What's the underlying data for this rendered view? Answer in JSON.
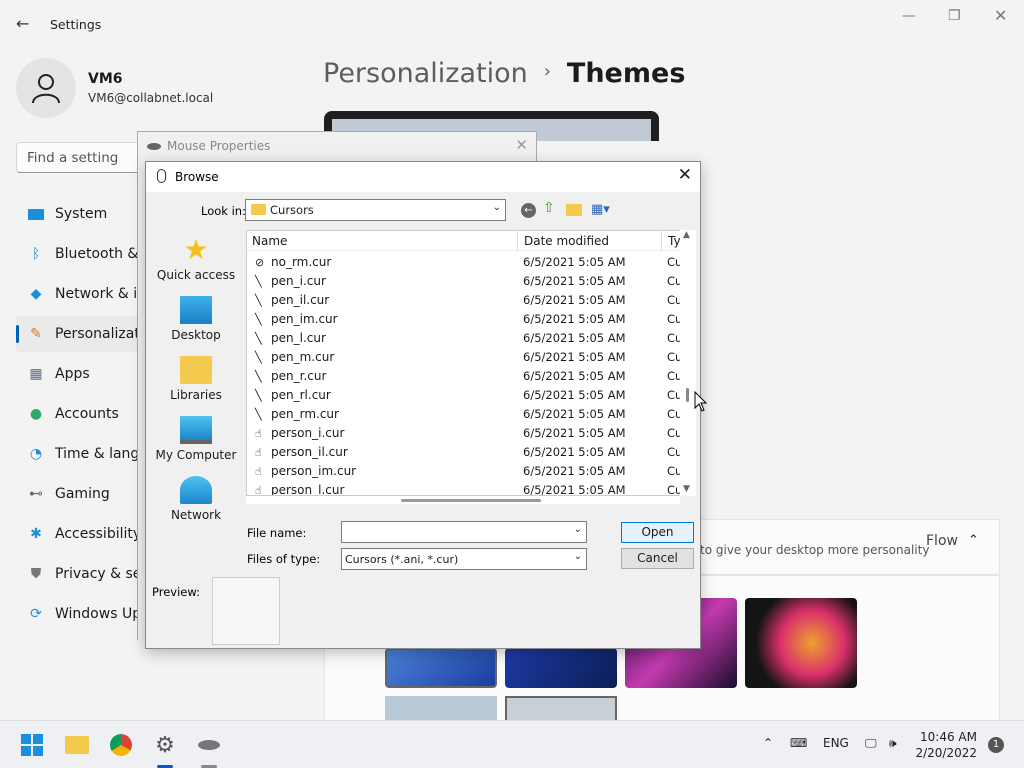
{
  "settings": {
    "title": "Settings",
    "user": {
      "name": "VM6",
      "email": "VM6@collabnet.local"
    },
    "search_placeholder": "Find a setting",
    "nav": [
      {
        "label": "System",
        "icon": "monitor-icon"
      },
      {
        "label": "Bluetooth & devices",
        "icon": "bluetooth-icon"
      },
      {
        "label": "Network & internet",
        "icon": "wifi-icon"
      },
      {
        "label": "Personalization",
        "icon": "brush-icon",
        "selected": true
      },
      {
        "label": "Apps",
        "icon": "apps-icon"
      },
      {
        "label": "Accounts",
        "icon": "person-icon"
      },
      {
        "label": "Time & language",
        "icon": "clock-globe-icon"
      },
      {
        "label": "Gaming",
        "icon": "gamepad-icon"
      },
      {
        "label": "Accessibility",
        "icon": "accessibility-icon"
      },
      {
        "label": "Privacy & security",
        "icon": "shield-icon"
      },
      {
        "label": "Windows Update",
        "icon": "update-icon"
      }
    ],
    "breadcrumb": {
      "parent": "Personalization",
      "separator": "›",
      "current": "Themes"
    },
    "card_text": "to give your desktop more personality",
    "flow_label": "Flow"
  },
  "mouse_props": {
    "title": "Mouse Properties"
  },
  "browse": {
    "title": "Browse",
    "look_in_label": "Look in:",
    "look_in_value": "Cursors",
    "places": [
      "Quick access",
      "Desktop",
      "Libraries",
      "My Computer",
      "Network"
    ],
    "columns": {
      "name": "Name",
      "date": "Date modified",
      "type": "Ty"
    },
    "files": [
      {
        "name": "no_rm.cur",
        "date": "6/5/2021 5:05 AM",
        "type": "Cu",
        "icon": "no-icon"
      },
      {
        "name": "pen_i.cur",
        "date": "6/5/2021 5:05 AM",
        "type": "Cu",
        "icon": "pen-icon"
      },
      {
        "name": "pen_il.cur",
        "date": "6/5/2021 5:05 AM",
        "type": "Cu",
        "icon": "pen-icon"
      },
      {
        "name": "pen_im.cur",
        "date": "6/5/2021 5:05 AM",
        "type": "Cu",
        "icon": "pen-icon"
      },
      {
        "name": "pen_l.cur",
        "date": "6/5/2021 5:05 AM",
        "type": "Cu",
        "icon": "pen-icon"
      },
      {
        "name": "pen_m.cur",
        "date": "6/5/2021 5:05 AM",
        "type": "Cu",
        "icon": "pen-icon"
      },
      {
        "name": "pen_r.cur",
        "date": "6/5/2021 5:05 AM",
        "type": "Cu",
        "icon": "pen-icon"
      },
      {
        "name": "pen_rl.cur",
        "date": "6/5/2021 5:05 AM",
        "type": "Cu",
        "icon": "pen-icon"
      },
      {
        "name": "pen_rm.cur",
        "date": "6/5/2021 5:05 AM",
        "type": "Cu",
        "icon": "pen-icon"
      },
      {
        "name": "person_i.cur",
        "date": "6/5/2021 5:05 AM",
        "type": "Cu",
        "icon": "hand-person-icon"
      },
      {
        "name": "person_il.cur",
        "date": "6/5/2021 5:05 AM",
        "type": "Cu",
        "icon": "hand-person-icon"
      },
      {
        "name": "person_im.cur",
        "date": "6/5/2021 5:05 AM",
        "type": "Cu",
        "icon": "hand-person-icon"
      },
      {
        "name": "person_l.cur",
        "date": "6/5/2021 5:05 AM",
        "type": "Cu",
        "icon": "hand-person-icon"
      }
    ],
    "file_name_label": "File name:",
    "file_name_value": "",
    "file_type_label": "Files of type:",
    "file_type_value": "Cursors (*.ani, *.cur)",
    "open_label": "Open",
    "cancel_label": "Cancel",
    "preview_label": "Preview:"
  },
  "taskbar": {
    "lang": "ENG",
    "time": "10:46 AM",
    "date": "2/20/2022",
    "notification_count": "1"
  },
  "colors": {
    "accent": "#005fb8",
    "folder": "#f3c94e"
  }
}
